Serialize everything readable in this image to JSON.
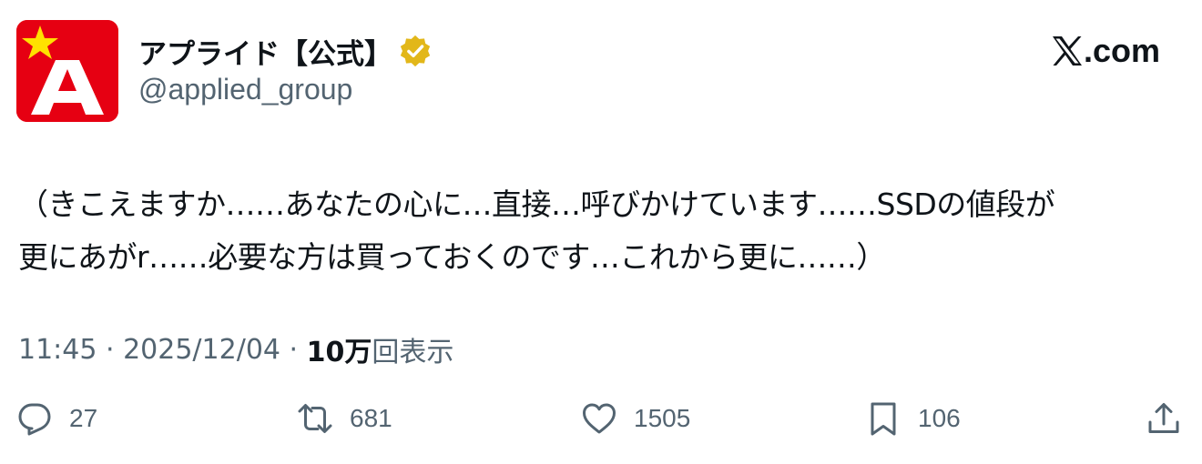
{
  "author": {
    "display_name": "アプライド【公式】",
    "handle": "@applied_group",
    "avatar_letter": "A",
    "avatar_color": "#e60012",
    "avatar_star_color": "#ffe100",
    "verified_badge_color": "#e2b719"
  },
  "source": {
    "site_label": ".com",
    "logo_icon": "x-logo-icon"
  },
  "tweet": {
    "lines": [
      "（きこえますか……あなたの心に…直接…呼びかけています……SSDの値段が",
      "更にあがr……必要な方は買っておくのです…これから更に……）"
    ]
  },
  "meta": {
    "time": "11:45",
    "separator": " · ",
    "date": "2025/12/04",
    "views_number": "10万",
    "views_label": "回表示"
  },
  "actions": {
    "reply_count": "27",
    "retweet_count": "681",
    "like_count": "1505",
    "bookmark_count": "106"
  },
  "colors": {
    "text_primary": "#0f1419",
    "text_secondary": "#536471"
  }
}
